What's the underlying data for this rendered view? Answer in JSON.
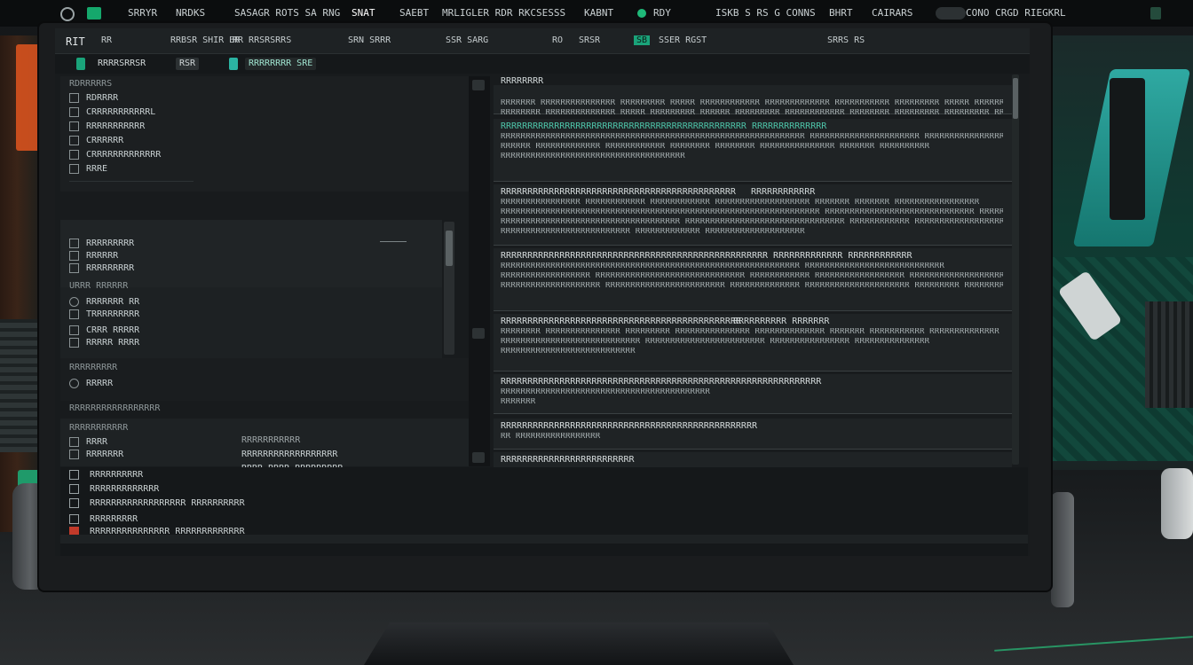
{
  "os_bar": {
    "items": [
      "SRRYR",
      "NRDKS",
      "SASAGR ROTS SA RNG",
      "SNAT",
      "SAEBT",
      "MRLIGLER RDR RKCSESSS",
      "KABNT",
      "RDY",
      "ISKB S RS G CONNS",
      "BHRT",
      "CAIRARS",
      "CONO CRGD RIEGKRL"
    ],
    "accent": "#15a86c"
  },
  "toolbar": {
    "items": [
      "RIT",
      "RR",
      "RRBSR SHIR BR",
      "RR RRSRSRRS",
      "SRN SRRR",
      "SSR SARG",
      "RO",
      "SRSR",
      "SB",
      "SSER RGST",
      "SRRS RS"
    ],
    "sub_label": "RRRRSRRSR",
    "sub_chip": "RSR",
    "sub_active": "RRRRRRRR SRE"
  },
  "tree": {
    "groups": [
      {
        "heading": "RDRRRRRS",
        "rows": [
          "RDRRRR",
          "CRRRRRRRRRRRL",
          "RRRRRRRRRRR",
          "CRRRRRR",
          "CRRRRRRRRRRRRR",
          "RRRE"
        ]
      },
      {
        "heading": "",
        "rows": [
          "RRRRRRRRR",
          "RRRRRR",
          "RRRRRRRRR"
        ]
      },
      {
        "heading": "URRR RRRRRR",
        "rows": [
          "RRRRRRR RR",
          "TRRRRRRRRR",
          "CRRR RRRRR",
          "RRRRR RRRR"
        ]
      },
      {
        "heading": "RRRRRRRRR",
        "rows": [
          "RRRRR"
        ]
      },
      {
        "heading": "RRRRRRRRRRRRRRRRR",
        "rows": []
      },
      {
        "heading": "RRRRRRRRRRR",
        "rows": [
          "RRRR",
          "RRRRRRR"
        ],
        "right": [
          "RRRRRRRRRRR",
          "RRRRRRRRRRRRRRRRRR",
          "RRRR RRRR RRRRRRRRR"
        ]
      }
    ]
  },
  "results": {
    "header": "RRRRRRRR",
    "cards": [
      {
        "title": "",
        "lines": [
          "RRRRRRR RRRRRRRRRRRRRRR RRRRRRRRR RRRRR RRRRRRRRRRRR RRRRRRRRRRRRR RRRRRRRRRRR RRRRRRRRR RRRRR RRRRRRR RRRRRRRRRRRRRR",
          "RRRRRRRR RRRRRRRRRRRRRR RRRRR RRRRRRRRR RRRRRR RRRRRRRRR RRRRRRRRRRRR RRRRRRRR RRRRRRRRR RRRRRRRRR RRRRRR RRRRR"
        ],
        "meta": ""
      },
      {
        "title": "RRRRRRRRRRRRRRRRRRRRRRRRRRRRRRRRRRRRRRRRRRRRRR RRRRRRRRRRRRRR",
        "teal": true,
        "lines": [
          "RRRRRRRRRRRRRRRRRRRRRRRRRRRRRRRRRRRRRRRRRRRRRRRRRRRRRRRRRRRRR RRRRRRRRRRRRRRRRRRRRRR RRRRRRRRRRRRRRRR RRRRRRRRRRRR RRRR RRRRRRR RRRRRR",
          "RRRRRR RRRRRRRRRRRRR RRRRRRRRRRRR RRRRRRRR RRRRRRRR RRRRRRRRRRRRRRR RRRRRRR RRRRRRRRRR",
          "RRRRRRRRRRRRRRRRRRRRRRRRRRRRRRRRRRRRR"
        ],
        "meta": ""
      },
      {
        "title": "RRRRRRRRRRRRRRRRRRRRRRRRRRRRRRRRRRRRRRRRRRRR",
        "lines": [
          "RRRRRRRRRRRRRRRR RRRRRRRRRRRR RRRRRRRRRRRR RRRRRRRRRRRRRRRRRRR RRRRRRR RRRRRRR RRRRRRRRRRRRRRRRR",
          "RRRRRRRRRRRRRRRRRRRRRRRRRRRRRRRRRRRRRRRRRRRRRRRRRRRRRRRRRRRRRRRR RRRRRRRRRRRRRRRRRRRRRRRRRRRRRR RRRRRRRRRRRRRRR RRRRRRRR",
          "RRRRRRRRRRRRRRRRRRRRRRRRRRRRRRRRRRRR RRRRRRRRRRRRRRRRRRRRRRRRRRRRRRRR RRRRRRRRRRRR RRRRRRRRRRRRRRRRRRRRRRR",
          "RRRRRRRRRRRRRRRRRRRRRRRRRR RRRRRRRRRRRRR RRRRRRRRRRRRRRRRRRRR"
        ],
        "meta": "RRRRRRRRRRRR"
      },
      {
        "title": "RRRRRRRRRRRRRRRRRRRRRRRRRRRRRRRRRRRRRRRRRRRRRRRRRR RRRRRRRRRRRRR RRRRRRRRRRRR",
        "lines": [
          "RRRRRRRRRRRRRRRRRRRRRRRRRRRRRRRRRRRRRRRRRRRRRRRRRRRRRRRRRRRR RRRRRRRRRRRRRRRRRRRRRRRRRRRR",
          "RRRRRRRRRRRRRRRRRR RRRRRRRRRRRRRRRRRRRRRRRRRRRRRR RRRRRRRRRRRR RRRRRRRRRRRRRRRRRR RRRRRRRRRRRRRRRRRRRRRRRR",
          "RRRRRRRRRRRRRRRRRRRR RRRRRRRRRRRRRRRRRRRRRRRR RRRRRRRRRRRRRR RRRRRRRRRRRRRRRRRRRRR RRRRRRRRR RRRRRRRR"
        ],
        "meta": ""
      },
      {
        "title": "RRRRRRRRRRRRRRRRRRRRRRRRRRRRRRRRRRRRRRRRRRRRR",
        "lines": [
          "RRRRRRRR RRRRRRRRRRRRRRR RRRRRRRRR RRRRRRRRRRRRRRR RRRRRRRRRRRRRR RRRRRRR RRRRRRRRRRR RRRRRRRRRRRRRR",
          "RRRRRRRRRRRRRRRRRRRRRRRRRRRR RRRRRRRRRRRRRRRRRRRRRRRR RRRRRRRRRRRRRRRR RRRRRRRRRRRRRRR",
          "RRRRRRRRRRRRRRRRRRRRRRRRRRR"
        ],
        "meta": "RRRRRRRRRR        RRRRRRR"
      },
      {
        "title": "RRRRRRRRRRRRRRRRRRRRRRRRRRRRRRRRRRRRRRRRRRRRRRRRRRRRRRRRRRRR",
        "lines": [
          "RRRRRRRRRRRRRRRRRRRRRRRRRRRRRRRRRRRRRRRRRR",
          "RRRRRRR"
        ],
        "meta": ""
      },
      {
        "title": "RRRRRRRRRRRRRRRRRRRRRRRRRRRRRRRRRRRRRRRRRRRRRRRR",
        "lines": [
          "RR RRRRRRRRRRRRRRRRR"
        ],
        "meta": ""
      },
      {
        "title": "RRRRRRRRRRRRRRRRRRRRRRRRR",
        "lines": [],
        "meta": ""
      }
    ]
  },
  "console": {
    "rows": [
      "RRRRRRRRRR",
      "RRRRRRRRRRRRR",
      "RRRRRRRRRRRRRRRRRR RRRRRRRRRR",
      "RRRRRRRRR",
      "RRRRRRRRRRRRRRR RRRRRRRRRRRRR"
    ]
  }
}
